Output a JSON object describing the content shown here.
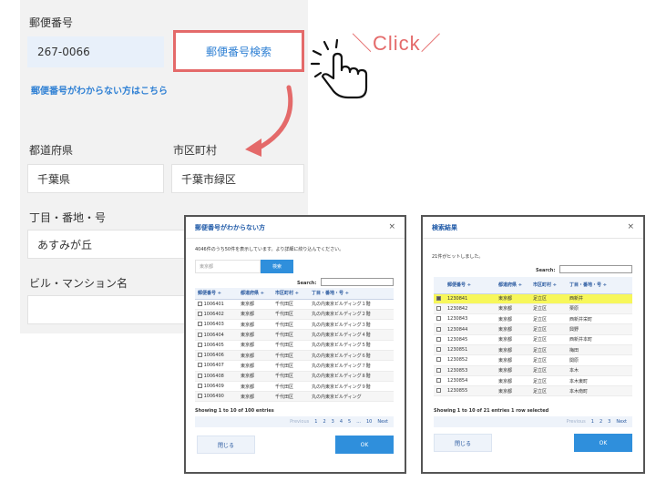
{
  "form": {
    "postal_label": "郵便番号",
    "postal_value": "267-0066",
    "search_button": "郵便番号検索",
    "unknown_link": "郵便番号がわからない方はこちら",
    "prefecture_label": "都道府県",
    "prefecture_value": "千葉県",
    "city_label": "市区町村",
    "city_value": "千葉市緑区",
    "street_label": "丁目・番地・号",
    "street_value": "あすみが丘",
    "building_label": "ビル・マンション名",
    "building_value": ""
  },
  "annotation": {
    "click_text": "＼Click／",
    "accent_color": "#e46a6a"
  },
  "modal_unknown": {
    "title": "郵便番号がわからない方",
    "close": "×",
    "info": "4046件のうち50件を表示しています。より詳細に絞り込んでください。",
    "input_placeholder": "東京都",
    "search_button": "検索",
    "search_label": "Search:",
    "headers": [
      "郵便番号 ÷ ",
      "都道府県 ÷",
      "市区町村 ÷",
      "丁目・番地・号 ÷"
    ],
    "rows": [
      [
        "1006401",
        "東京都",
        "千代田区",
        "丸の内東京ビルディング１階"
      ],
      [
        "1006402",
        "東京都",
        "千代田区",
        "丸の内東京ビルディング２階"
      ],
      [
        "1006403",
        "東京都",
        "千代田区",
        "丸の内東京ビルディング３階"
      ],
      [
        "1006404",
        "東京都",
        "千代田区",
        "丸の内東京ビルディング４階"
      ],
      [
        "1006405",
        "東京都",
        "千代田区",
        "丸の内東京ビルディング５階"
      ],
      [
        "1006406",
        "東京都",
        "千代田区",
        "丸の内東京ビルディング６階"
      ],
      [
        "1006407",
        "東京都",
        "千代田区",
        "丸の内東京ビルディング７階"
      ],
      [
        "1006408",
        "東京都",
        "千代田区",
        "丸の内東京ビルディング８階"
      ],
      [
        "1006409",
        "東京都",
        "千代田区",
        "丸の内東京ビルディング９階"
      ],
      [
        "1006490",
        "東京都",
        "千代田区",
        "丸の内東京ビルディング"
      ]
    ],
    "entries": "Showing 1 to 10 of 100 entries",
    "pager": [
      "Previous",
      "1",
      "2",
      "3",
      "4",
      "5",
      "...",
      "10",
      "Next"
    ],
    "close_button": "閉じる",
    "ok_button": "OK"
  },
  "modal_results": {
    "title": "検索結果",
    "close": "×",
    "info": "21件がヒットしました。",
    "search_label": "Search:",
    "headers": [
      "郵便番号 ÷",
      "都道府県 ÷",
      "市区町村 ÷",
      "丁目・番地・号 ÷"
    ],
    "rows": [
      [
        "1230841",
        "東京都",
        "足立区",
        "西新井"
      ],
      [
        "1230842",
        "東京都",
        "足立区",
        "栗原"
      ],
      [
        "1230843",
        "東京都",
        "足立区",
        "西新井栄町"
      ],
      [
        "1230844",
        "東京都",
        "足立区",
        "興野"
      ],
      [
        "1230845",
        "東京都",
        "足立区",
        "西新井本町"
      ],
      [
        "1230851",
        "東京都",
        "足立区",
        "梅田"
      ],
      [
        "1230852",
        "東京都",
        "足立区",
        "関原"
      ],
      [
        "1230853",
        "東京都",
        "足立区",
        "本木"
      ],
      [
        "1230854",
        "東京都",
        "足立区",
        "本木東町"
      ],
      [
        "1230855",
        "東京都",
        "足立区",
        "本木南町"
      ]
    ],
    "entries": "Showing 1 to 10 of 21 entries   1 row selected",
    "pager": [
      "Previous",
      "1",
      "2",
      "3",
      "Next"
    ],
    "close_button": "閉じる",
    "ok_button": "OK"
  }
}
